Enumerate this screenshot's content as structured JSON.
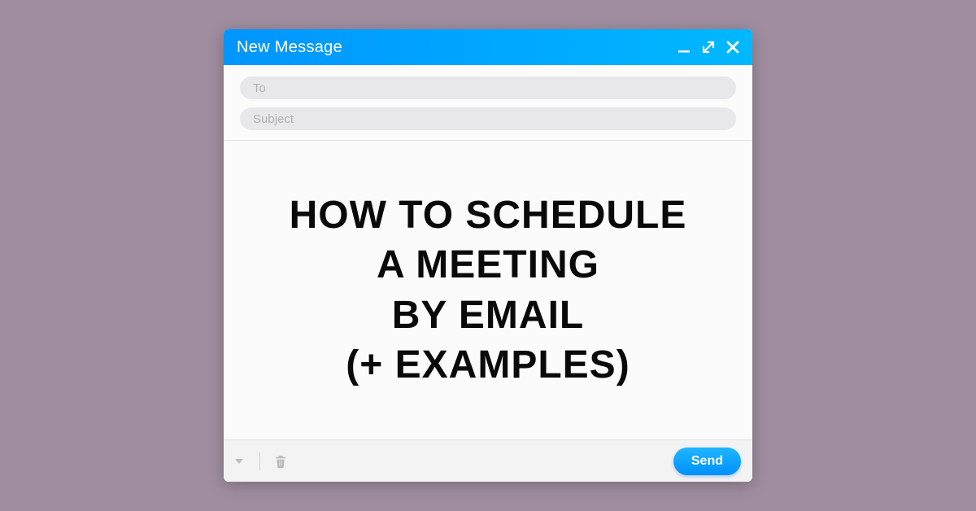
{
  "window": {
    "title": "New Message"
  },
  "fields": {
    "to_placeholder": "To",
    "to_value": "",
    "subject_placeholder": "Subject",
    "subject_value": ""
  },
  "body": {
    "heading": "HOW TO SCHEDULE\nA MEETING\nBY EMAIL\n(+ EXAMPLES)"
  },
  "footer": {
    "send_label": "Send"
  },
  "icons": {
    "minimize": "minimize-icon",
    "expand": "expand-icon",
    "close": "close-icon",
    "more": "more-icon",
    "trash": "trash-icon"
  }
}
